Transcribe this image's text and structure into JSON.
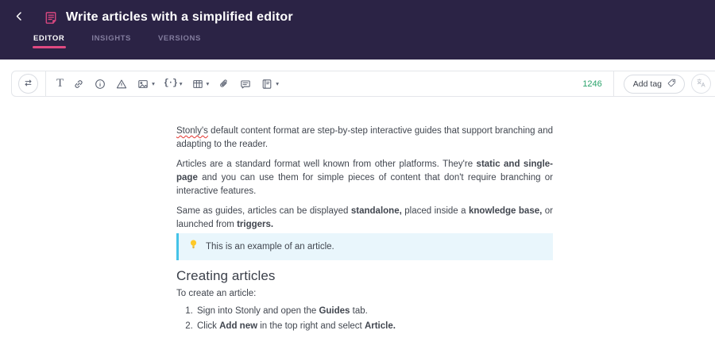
{
  "header": {
    "title": "Write articles with a simplified editor",
    "tabs": [
      {
        "label": "EDITOR",
        "active": true
      },
      {
        "label": "INSIGHTS",
        "active": false
      },
      {
        "label": "VERSIONS",
        "active": false
      }
    ]
  },
  "toolbar": {
    "tools": [
      "swap-step-type",
      "text",
      "link",
      "info-block",
      "warning-block",
      "image",
      "code-embed",
      "table",
      "attachment",
      "note-callout",
      "guide-embed"
    ],
    "count": "1246",
    "add_tag_label": "Add tag"
  },
  "icons": {
    "caret": "▾",
    "text_tool_glyph": "T",
    "code_tool_glyph": "{·}"
  },
  "content": {
    "paragraphs": [
      [
        {
          "t": "Stonly's",
          "misspelled": true
        },
        {
          "t": " default content format are step-by-step interactive guides that support branching and adapting to the reader."
        }
      ],
      [
        {
          "t": "Articles are a standard format well known from other platforms. They're "
        },
        {
          "t": "static and single-page",
          "b": true
        },
        {
          "t": " and you can use them for simple pieces of content that don't require branching or interactive features."
        }
      ],
      [
        {
          "t": "Same as guides, articles can be displayed "
        },
        {
          "t": "standalone,",
          "b": true
        },
        {
          "t": " placed inside a "
        },
        {
          "t": "knowledge base,",
          "b": true
        },
        {
          "t": " or launched from "
        },
        {
          "t": "triggers.",
          "b": true
        }
      ]
    ],
    "callout": {
      "icon": "lightbulb",
      "text": "This is an example of an article."
    },
    "heading": "Creating articles",
    "intro": "To create an article:",
    "steps": [
      [
        {
          "t": "Sign into Stonly and open the "
        },
        {
          "t": "Guides",
          "b": true
        },
        {
          "t": " tab."
        }
      ],
      [
        {
          "t": "Click "
        },
        {
          "t": "Add new",
          "b": true
        },
        {
          "t": " in the top right and select "
        },
        {
          "t": "Article.",
          "b": true
        }
      ]
    ]
  },
  "colors": {
    "header_bg": "#2b2345",
    "accent_pink": "#df4a81",
    "tab_inactive": "#837d9e",
    "toolbar_icon": "#596070",
    "count_green": "#2aa36b",
    "callout_bg": "#e9f6fc",
    "callout_border": "#45c3e8",
    "body_text": "#41464f",
    "border_gray": "#e4e6ea"
  }
}
